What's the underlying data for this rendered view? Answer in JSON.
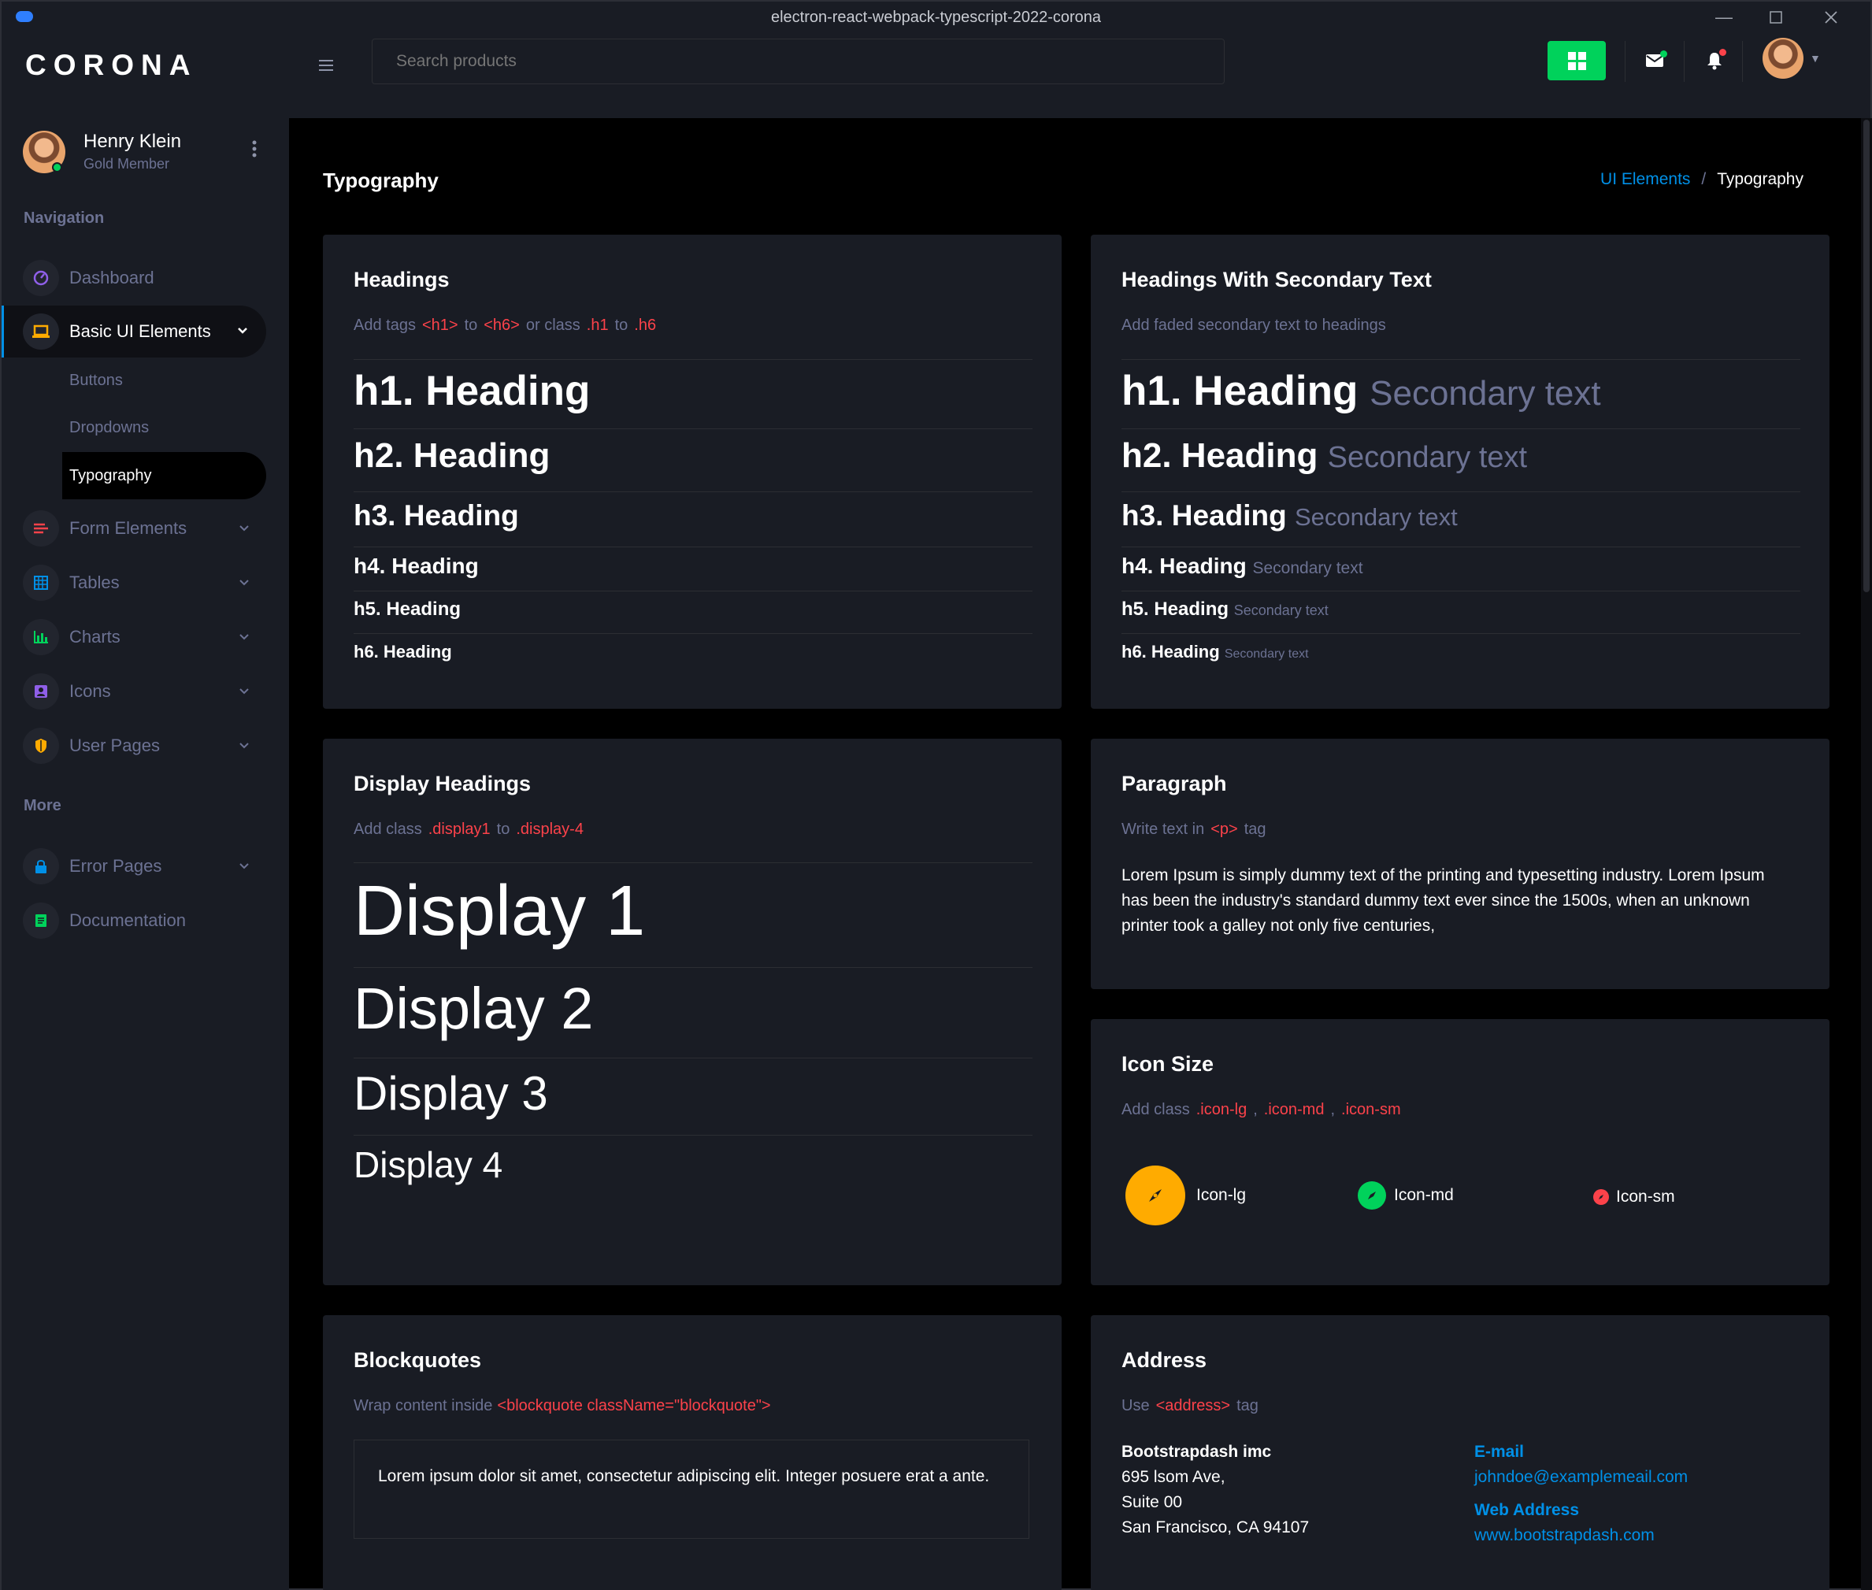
{
  "window": {
    "title": "electron-react-webpack-typescript-2022-corona"
  },
  "brand": "CORONA",
  "search": {
    "placeholder": "Search products"
  },
  "profile": {
    "name": "Henry Klein",
    "subtitle": "Gold Member"
  },
  "nav": {
    "category_navigation": "Navigation",
    "category_more": "More",
    "items": [
      {
        "label": "Dashboard",
        "icon": "speedometer-icon",
        "color": "#8f5fe8"
      },
      {
        "label": "Basic UI Elements",
        "icon": "laptop-icon",
        "color": "#ffab00"
      },
      {
        "label": "Form Elements",
        "icon": "playlist-icon",
        "color": "#fc424a"
      },
      {
        "label": "Tables",
        "icon": "table-icon",
        "color": "#0090e7"
      },
      {
        "label": "Charts",
        "icon": "chart-bar-icon",
        "color": "#00d25b"
      },
      {
        "label": "Icons",
        "icon": "contacts-icon",
        "color": "#8f5fe8"
      },
      {
        "label": "User Pages",
        "icon": "security-icon",
        "color": "#ffab00"
      },
      {
        "label": "Error Pages",
        "icon": "lock-icon",
        "color": "#0090e7"
      },
      {
        "label": "Documentation",
        "icon": "file-document-icon",
        "color": "#00d25b"
      }
    ],
    "sub_items": [
      "Buttons",
      "Dropdowns",
      "Typography"
    ]
  },
  "page": {
    "title": "Typography",
    "breadcrumb": {
      "parent": "UI Elements",
      "separator": "/",
      "current": "Typography"
    }
  },
  "headings_card": {
    "title": "Headings",
    "desc_prefix": "Add tags",
    "code1": "<h1>",
    "to1": "to",
    "code2": "<h6>",
    "or": "or class",
    "code3": ".h1",
    "to2": "to",
    "code4": ".h6",
    "h1": "h1. Heading",
    "h2": "h2. Heading",
    "h3": "h3. Heading",
    "h4": "h4. Heading",
    "h5": "h5. Heading",
    "h6": "h6. Heading"
  },
  "secondary_card": {
    "title": "Headings With Secondary Text",
    "desc": "Add faded secondary text to headings",
    "secondary": "Secondary text"
  },
  "display_card": {
    "title": "Display Headings",
    "desc_prefix": "Add class",
    "code1": ".display1",
    "to": "to",
    "code2": ".display-4",
    "d1": "Display 1",
    "d2": "Display 2",
    "d3": "Display 3",
    "d4": "Display 4"
  },
  "paragraph_card": {
    "title": "Paragraph",
    "desc_prefix": "Write text in",
    "code": "<p>",
    "desc_suffix": "tag",
    "text": "Lorem Ipsum is simply dummy text of the printing and typesetting industry. Lorem Ipsum has been the industry's standard dummy text ever since the 1500s, when an unknown printer took a galley not only five centuries,"
  },
  "icon_size_card": {
    "title": "Icon Size",
    "desc_prefix": "Add class",
    "code1": ".icon-lg",
    "comma1": ",",
    "code2": ".icon-md",
    "comma2": ",",
    "code3": ".icon-sm",
    "lg": "Icon-lg",
    "md": "Icon-md",
    "sm": "Icon-sm",
    "colors": {
      "lg": "#ffab00",
      "md": "#00d25b",
      "sm": "#fc424a"
    }
  },
  "blockquote_card": {
    "title": "Blockquotes",
    "desc_prefix": "Wrap content inside",
    "code": "<blockquote className=\"blockquote\">",
    "text": "Lorem ipsum dolor sit amet, consectetur adipiscing elit. Integer posuere erat a ante."
  },
  "address_card": {
    "title": "Address",
    "desc_prefix": "Use",
    "code": "<address>",
    "desc_suffix": "tag",
    "company": "Bootstrapdash imc",
    "line1": "695 lsom Ave,",
    "line2": "Suite 00",
    "line3": "San Francisco, CA 94107",
    "email_label": "E-mail",
    "email": "johndoe@examplemeail.com",
    "web_label": "Web Address",
    "web": "www.bootstrapdash.com"
  },
  "colors": {
    "accent_blue": "#0090e7",
    "success": "#00d25b",
    "danger": "#fc424a",
    "warning": "#ffab00",
    "muted": "#6c7293"
  }
}
